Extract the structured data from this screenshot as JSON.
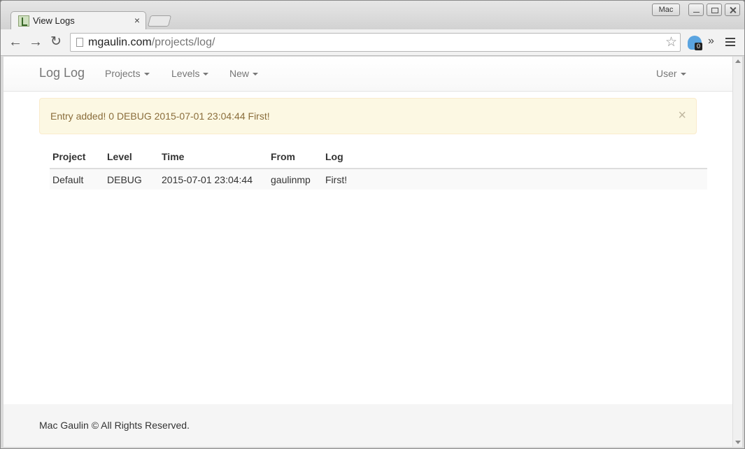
{
  "browser": {
    "tab_title": "View Logs",
    "tab_close": "×",
    "profile_label": "Mac",
    "url_host": "mgaulin.com",
    "url_path": "/projects/log/",
    "extension_badge": "0",
    "overflow": "»"
  },
  "navbar": {
    "brand": "Log Log",
    "items": [
      {
        "label": "Projects"
      },
      {
        "label": "Levels"
      },
      {
        "label": "New"
      }
    ],
    "user_label": "User"
  },
  "alert": {
    "text": "Entry added! 0 DEBUG 2015-07-01 23:04:44 First!",
    "close": "×",
    "color": "#fcf8e3"
  },
  "table": {
    "headers": [
      "Project",
      "Level",
      "Time",
      "From",
      "Log"
    ],
    "rows": [
      [
        "Default",
        "DEBUG",
        "2015-07-01 23:04:44",
        "gaulinmp",
        "First!"
      ]
    ]
  },
  "footer": {
    "text": "Mac Gaulin © All Rights Reserved."
  }
}
